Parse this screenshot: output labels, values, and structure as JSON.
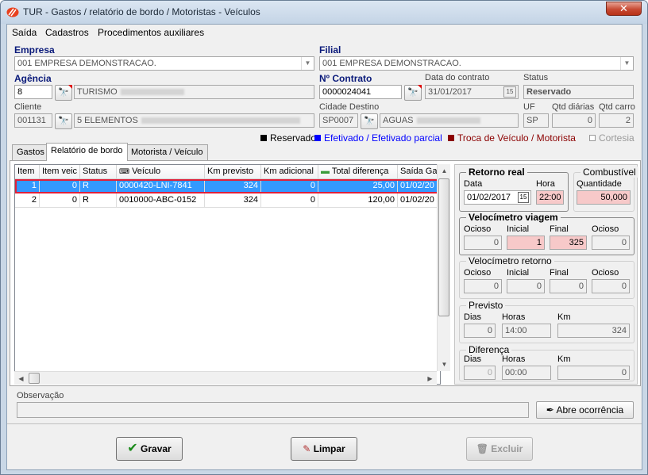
{
  "window": {
    "title": "TUR - Gastos / relatório de bordo / Motoristas - Veículos",
    "close_glyph": "✕"
  },
  "menu": [
    "Saída",
    "Cadastros",
    "Procedimentos auxiliares"
  ],
  "form": {
    "empresa_label": "Empresa",
    "empresa_value": "001 EMPRESA DEMONSTRACAO.",
    "filial_label": "Filial",
    "filial_value": "001 EMPRESA DEMONSTRACAO.",
    "agencia_label": "Agência",
    "agencia_code": "8",
    "agencia_name": "TURISMO",
    "contrato_label": "Nº Contrato",
    "contrato_value": "0000024041",
    "data_contrato_label": "Data do contrato",
    "data_contrato_value": "31/01/2017",
    "status_label": "Status",
    "status_value": "Reservado",
    "cliente_label": "Cliente",
    "cliente_code": "001131",
    "cliente_name": "5 ELEMENTOS",
    "cidade_label": "Cidade Destino",
    "cidade_code": "SP0007",
    "cidade_name": "AGUAS",
    "uf_label": "UF",
    "uf_value": "SP",
    "qtd_diarias_label": "Qtd diárias",
    "qtd_diarias_value": "0",
    "qtd_carro_label": "Qtd carro",
    "qtd_carro_value": "2"
  },
  "legend": [
    {
      "label": "Reservado",
      "color": "#000000"
    },
    {
      "label": "Efetivado / Efetivado parcial",
      "color": "#0000ff"
    },
    {
      "label": "Troca de Veículo / Motorista",
      "color": "#8b0000"
    },
    {
      "label": "Cortesia",
      "color": "#999999"
    }
  ],
  "tabs": [
    "Gastos",
    "Relatório de bordo",
    "Motorista / Veículo"
  ],
  "grid": {
    "columns": [
      "Item",
      "Item veic",
      "Status",
      "Veículo",
      "Km previsto",
      "Km adicional",
      "Total diferença",
      "Saída Ga"
    ],
    "rows": [
      [
        "1",
        "0",
        "R",
        "0000420-LNI-7841",
        "324",
        "0",
        "25,00",
        "01/02/20"
      ],
      [
        "2",
        "0",
        "R",
        "0010000-ABC-0152",
        "324",
        "0",
        "120,00",
        "01/02/20"
      ]
    ]
  },
  "retorno": {
    "title": "Retorno real",
    "data_label": "Data",
    "data_value": "01/02/2017",
    "hora_label": "Hora",
    "hora_value": "22:00"
  },
  "combustivel": {
    "title": "Combustível",
    "qtd_label": "Quantidade",
    "qtd_value": "50,000"
  },
  "vel_viagem": {
    "title": "Velocímetro viagem",
    "ocioso1_label": "Ocioso",
    "ocioso1": "0",
    "inicial_label": "Inicial",
    "inicial": "1",
    "final_label": "Final",
    "final": "325",
    "ocioso2_label": "Ocioso",
    "ocioso2": "0"
  },
  "vel_retorno": {
    "title": "Velocímetro retorno",
    "ocioso1_label": "Ocioso",
    "ocioso1": "0",
    "inicial_label": "Inicial",
    "inicial": "0",
    "final_label": "Final",
    "final": "0",
    "ocioso2_label": "Ocioso",
    "ocioso2": "0"
  },
  "previsto": {
    "title": "Previsto",
    "dias_label": "Dias",
    "dias": "0",
    "horas_label": "Horas",
    "horas": "14:00",
    "km_label": "Km",
    "km": "324"
  },
  "diferenca": {
    "title": "Diferença",
    "dias_label": "Dias",
    "dias": "0",
    "horas_label": "Horas",
    "horas": "00:00",
    "km_label": "Km",
    "km": "0"
  },
  "observacao": {
    "label": "Observação",
    "value": "",
    "abre_label": "Abre ocorrência"
  },
  "actions": {
    "gravar": "Gravar",
    "limpar": "Limpar",
    "excluir": "Excluir"
  }
}
